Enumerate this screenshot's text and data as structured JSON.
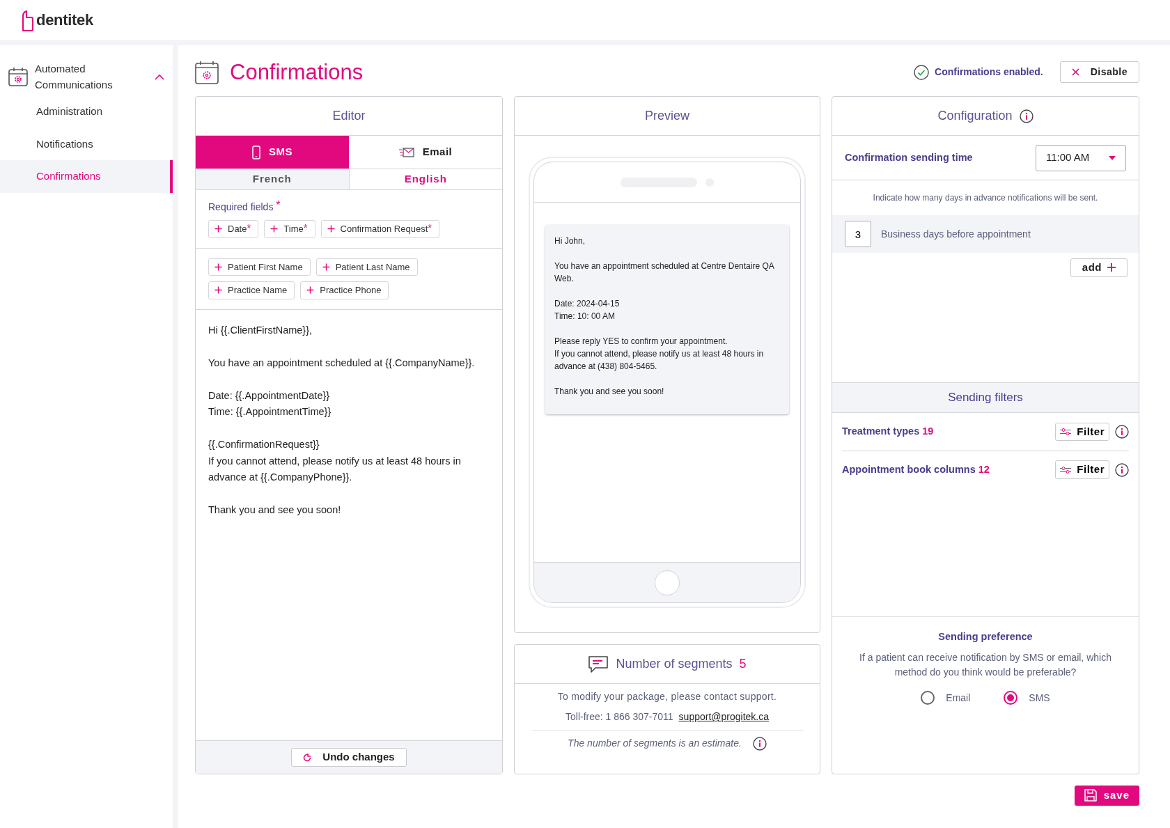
{
  "brand": {
    "name": "dentitek"
  },
  "sidebar": {
    "group": {
      "label": "Automated Communications",
      "expanded": true
    },
    "items": [
      {
        "label": "Administration",
        "selected": false
      },
      {
        "label": "Notifications",
        "selected": false
      },
      {
        "label": "Confirmations",
        "selected": true
      }
    ]
  },
  "page": {
    "title": "Confirmations",
    "status": "Confirmations enabled.",
    "disable_button": "Disable"
  },
  "editor": {
    "title": "Editor",
    "channel_tabs": [
      {
        "label": "SMS",
        "kind": "phone",
        "selected": true
      },
      {
        "label": "Email",
        "kind": "mail",
        "selected": false
      }
    ],
    "language_tabs": [
      {
        "label": "French",
        "selected": false
      },
      {
        "label": "English",
        "selected": true
      }
    ],
    "required_label": "Required fields",
    "required_marker": "*",
    "required_fields": [
      {
        "label": "Date",
        "marker": "*"
      },
      {
        "label": "Time",
        "marker": "*"
      },
      {
        "label": "Confirmation Request",
        "marker": "*"
      }
    ],
    "optional_fields": [
      "Patient First Name",
      "Patient Last Name",
      "Practice Name",
      "Practice Phone"
    ],
    "message": "Hi {{.ClientFirstName}},\n\nYou have an appointment scheduled at {{.CompanyName}}.\n\nDate: {{.AppointmentDate}}\nTime: {{.AppointmentTime}}\n\n{{.ConfirmationRequest}}\nIf you cannot attend, please notify us at least 48 hours in advance at {{.CompanyPhone}}.\n\nThank you and see you soon!",
    "undo_button": "Undo changes"
  },
  "preview": {
    "title": "Preview",
    "message_paragraphs": [
      "Hi John,",
      "You have an appointment scheduled at Centre Dentaire QA Web.",
      "Date: 2024-04-15\nTime: 10: 00 AM",
      "Please reply YES to confirm your appointment.\nIf you cannot attend, please notify us at least 48 hours in advance at (438) 804-5465.",
      "Thank you and see you soon!"
    ]
  },
  "segments": {
    "title": "Number of segments",
    "count": "5",
    "contact_text": "To modify your package, please contact support.",
    "phone": "Toll-free: 1 866 307-7011",
    "email": "support@progitek.ca",
    "note": "The number of segments is an estimate."
  },
  "configuration": {
    "title": "Configuration",
    "sending_time_label": "Confirmation sending time",
    "sending_time": "11:00 AM",
    "days_hint": "Indicate how many days in advance notifications will be sent.",
    "days": [
      {
        "value": "3",
        "label": "Business days before appointment"
      }
    ],
    "add_button": "add",
    "filters_title": "Sending filters",
    "filters": [
      {
        "label": "Treatment types",
        "count": "19",
        "button": "Filter"
      },
      {
        "label": "Appointment book columns",
        "count": "12",
        "button": "Filter"
      }
    ],
    "preference_title": "Sending preference",
    "preference_text": "If a patient can receive notification by SMS or email, which method do you think would be preferable?",
    "preference_options": [
      {
        "label": "Email",
        "selected": false
      },
      {
        "label": "SMS",
        "selected": true
      }
    ]
  },
  "save_button": "save"
}
